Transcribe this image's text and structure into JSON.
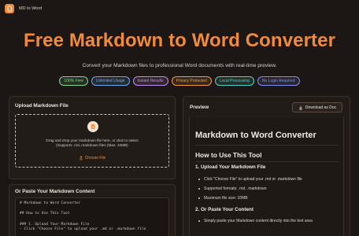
{
  "topbar": {
    "brand": "MD to Word"
  },
  "hero": {
    "title": "Free Markdown to Word Converter",
    "subtitle": "Convert your Markdown files to professional Word documents with real-time preview."
  },
  "badges": [
    {
      "label": "100% Free",
      "color": "#7bd88f"
    },
    {
      "label": "Unlimited Usage",
      "color": "#6aa9f0"
    },
    {
      "label": "Instant Results",
      "color": "#c08bf0"
    },
    {
      "label": "Privacy Protected",
      "color": "#f09a4a"
    },
    {
      "label": "Local Processing",
      "color": "#4fd1c5"
    },
    {
      "label": "No Login Required",
      "color": "#7f8ff0"
    }
  ],
  "upload": {
    "title": "Upload Markdown File",
    "instructions": "Drag and drop your markdown file here, or click to select",
    "supported": "(Supports .md,.markdown files (Max: 10MB)",
    "choose_label": "Choose File"
  },
  "paste": {
    "title": "Or Paste Your Markdown Content",
    "content": "# Markdown to Word Converter\n\n## How to Use This Tool\n\n### 1. Upload Your Markdown File\n- Click \"Choose File\" to upload your .md or .markdown file"
  },
  "preview": {
    "title": "Preview",
    "download_label": "Download as Doc",
    "h1": "Markdown to Word Converter",
    "h2": "How to Use This Tool",
    "sections": [
      {
        "heading": "1. Upload Your Markdown File",
        "items": [
          "Click \"Choose File\" to upload your .md or .markdown file",
          "Supported formats: .md, .markdown",
          "Maximum file size: 10MB"
        ]
      },
      {
        "heading": "2. Or Paste Your Content",
        "items": [
          "Simply paste your Markdown content directly into the text area"
        ]
      }
    ]
  },
  "colors": {
    "accent": "#f08a3c",
    "background": "#1c1714",
    "panel": "#221c18"
  }
}
